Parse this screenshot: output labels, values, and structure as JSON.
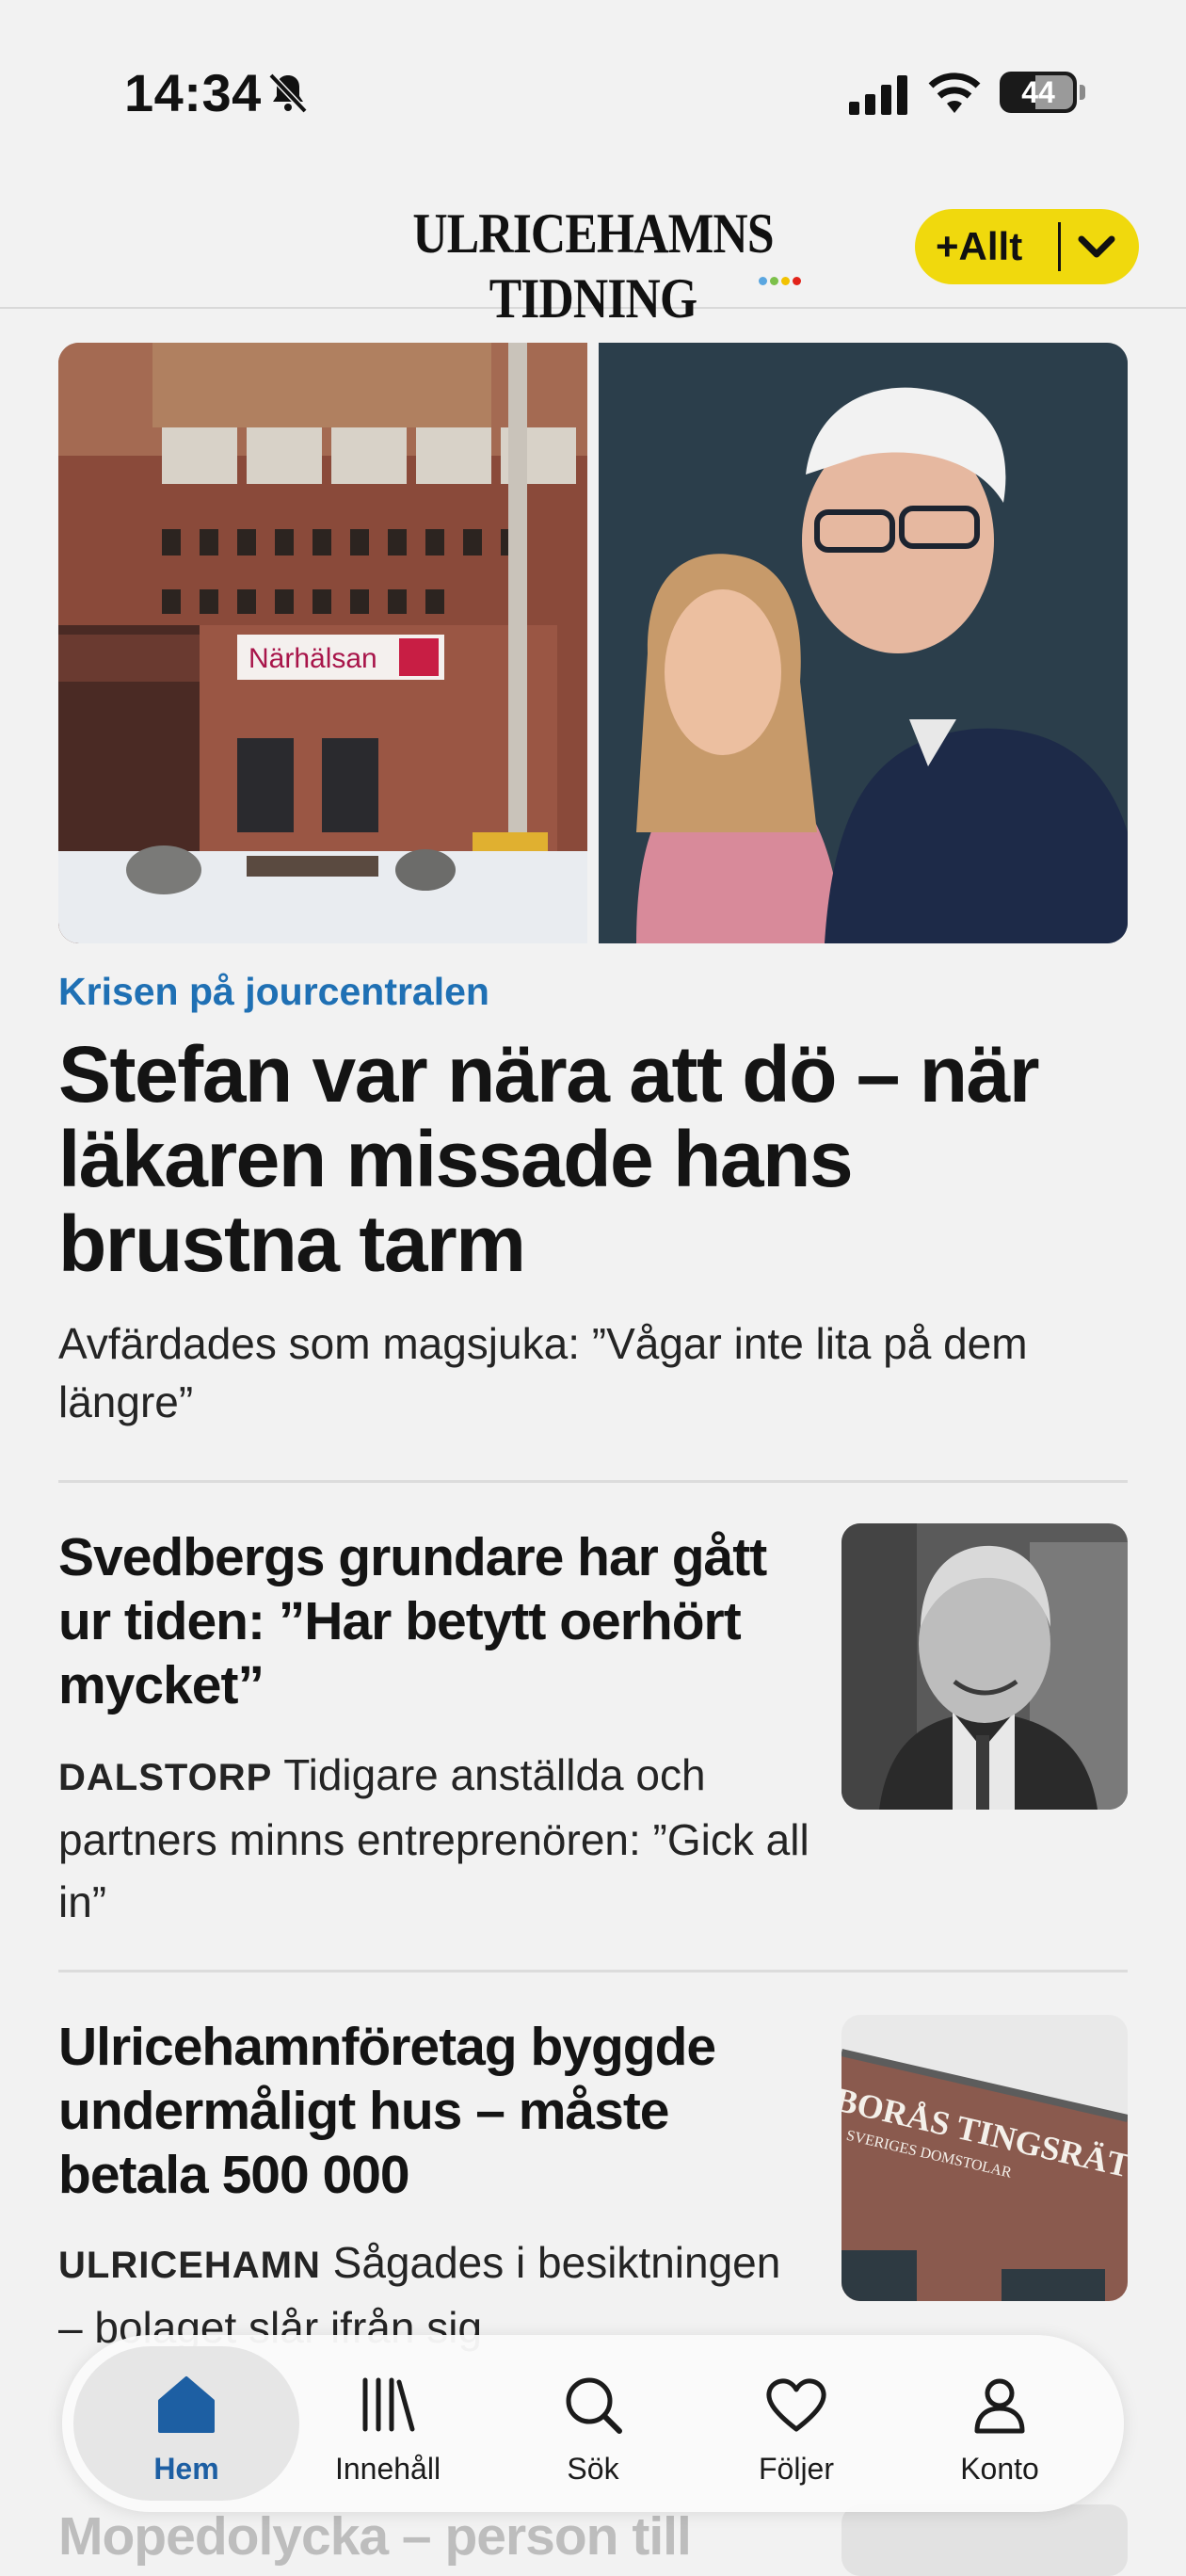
{
  "status_bar": {
    "time": "14:34",
    "battery": "44"
  },
  "header": {
    "brand": "ULRICEHAMNS TIDNING",
    "plus_button_label": "+Allt",
    "colors": {
      "plus_button": "#f0d90d"
    }
  },
  "lead": {
    "image_sign_text": "Närhälsan",
    "kicker": "Krisen på jourcentralen",
    "title": "Stefan var nära att dö – när läkaren missade hans brustna tarm",
    "subtitle": "Avfärdades som magsjuka: ”Vågar inte lita på dem längre”"
  },
  "articles": [
    {
      "title": "Svedbergs grundare har gått ur tiden: ”Har betytt oerhört mycket”",
      "place": "DALSTORP",
      "text": "Tidigare anställda och partners minns entreprenören: ”Gick all in”"
    },
    {
      "title": "Ulricehamnföretag byggde undermåligt hus – måste betala 500 000",
      "place": "ULRICEHAMN",
      "text": "Sågades i besiktningen – bolaget slår ifrån sig",
      "thumb_sign": "BORÅS TINGSRÄTT",
      "thumb_sign_sub": "SVERIGES DOMSTOLAR"
    },
    {
      "title": "Mopedolycka – person till"
    }
  ],
  "tab_bar": {
    "tabs": [
      {
        "label": "Hem",
        "icon": "home-icon",
        "active": true
      },
      {
        "label": "Innehåll",
        "icon": "library-icon",
        "active": false
      },
      {
        "label": "Sök",
        "icon": "search-icon",
        "active": false
      },
      {
        "label": "Följer",
        "icon": "heart-icon",
        "active": false
      },
      {
        "label": "Konto",
        "icon": "account-icon",
        "active": false
      }
    ],
    "colors": {
      "active": "#1d5fa3"
    }
  },
  "colors": {
    "kicker": "#1f70b4",
    "background": "#f2f2f2"
  }
}
